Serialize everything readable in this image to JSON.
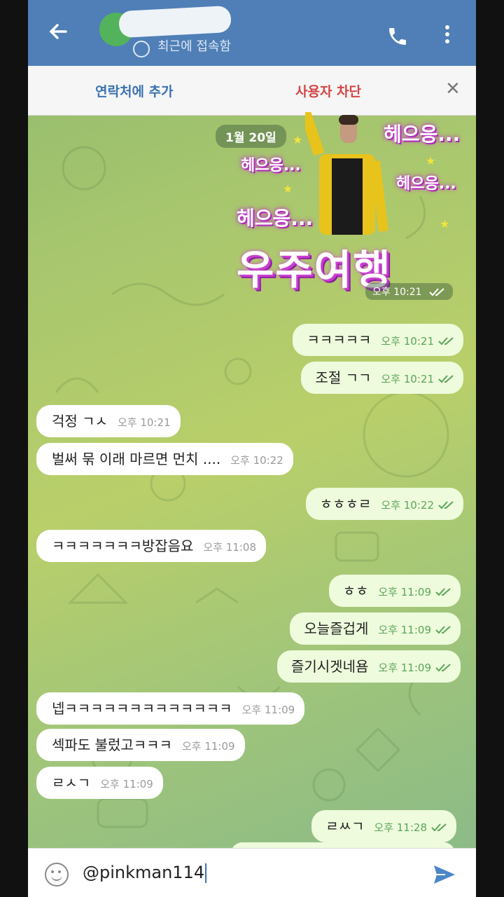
{
  "header": {
    "status": "최근에 접속함"
  },
  "actionbar": {
    "add_contact": "연락처에 추가",
    "block_user": "사용자 차단"
  },
  "date": "1월 20일",
  "sticker": {
    "texts": [
      "헤으응...",
      "헤으응...",
      "헤으응...",
      "헤으응..."
    ],
    "big_text": "우주여행",
    "time": "오후 10:21"
  },
  "messages": [
    {
      "dir": "out",
      "text": "ㅋㅋㅋㅋㅋ",
      "time": "오후 10:21"
    },
    {
      "dir": "out",
      "text": "조절 ㄱㄱ",
      "time": "오후 10:21"
    },
    {
      "dir": "in",
      "text": "걱정 ㄱㅅ",
      "time": "오후 10:21"
    },
    {
      "dir": "in",
      "text": "벌써 묶 이래 마르면 먼치 ....",
      "time": "오후 10:22"
    },
    {
      "dir": "out",
      "text": "ㅎㅎㅎㄹ",
      "time": "오후 10:22"
    },
    {
      "dir": "in",
      "text": "ㅋㅋㅋㅋㅋㅋㅋ방잡음요",
      "time": "오후 11:08"
    },
    {
      "dir": "out",
      "text": "ㅎㅎ",
      "time": "오후 11:09"
    },
    {
      "dir": "out",
      "text": "오늘즐겁게",
      "time": "오후 11:09"
    },
    {
      "dir": "out",
      "text": "즐기시겟네욤",
      "time": "오후 11:09"
    },
    {
      "dir": "in",
      "text": "넵ㅋㅋㅋㅋㅋㅋㅋㅋㅋㅋㅋㅋㅋ",
      "time": "오후 11:09"
    },
    {
      "dir": "in",
      "text": "섹파도 불렀고ㅋㅋㅋ",
      "time": "오후 11:09"
    },
    {
      "dir": "in",
      "text": "ㄹㅅㄱ",
      "time": "오후 11:09"
    },
    {
      "dir": "out",
      "text": "ㄹㅆㄱ",
      "time": "오후 11:28"
    }
  ],
  "input": {
    "value": "@pinkman114"
  },
  "colors": {
    "header": "#4f7fb6",
    "outgoing": "#eefbdc",
    "incoming": "#ffffff",
    "link_blue": "#3b72b1",
    "block_red": "#d34545"
  },
  "icons": [
    "back-arrow-icon",
    "clock-icon",
    "phone-icon",
    "more-vertical-icon",
    "close-icon",
    "emoji-icon",
    "send-icon",
    "double-check-icon"
  ]
}
